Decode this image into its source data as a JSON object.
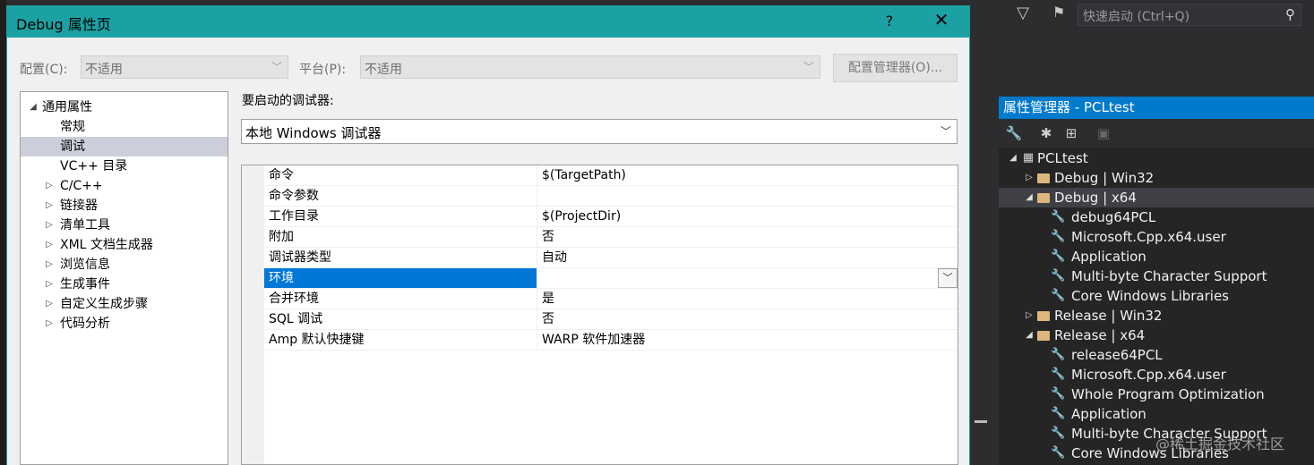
{
  "dialog": {
    "title": "Debug 属性页",
    "help": "?",
    "close": "✕",
    "config_label": "配置(C):",
    "config_value": "不适用",
    "platform_label": "平台(P):",
    "platform_value": "不适用",
    "config_manager": "配置管理器(O)...",
    "nav": [
      {
        "label": "通用属性",
        "expander": "◢",
        "indent": 0
      },
      {
        "label": "常规",
        "expander": "",
        "indent": 1
      },
      {
        "label": "调试",
        "expander": "",
        "indent": 1,
        "selected": true
      },
      {
        "label": "VC++ 目录",
        "expander": "",
        "indent": 1
      },
      {
        "label": "C/C++",
        "expander": "▷",
        "indent": 1
      },
      {
        "label": "链接器",
        "expander": "▷",
        "indent": 1
      },
      {
        "label": "清单工具",
        "expander": "▷",
        "indent": 1
      },
      {
        "label": "XML 文档生成器",
        "expander": "▷",
        "indent": 1
      },
      {
        "label": "浏览信息",
        "expander": "▷",
        "indent": 1
      },
      {
        "label": "生成事件",
        "expander": "▷",
        "indent": 1
      },
      {
        "label": "自定义生成步骤",
        "expander": "▷",
        "indent": 1
      },
      {
        "label": "代码分析",
        "expander": "▷",
        "indent": 1
      }
    ],
    "debugger_label": "要启动的调试器:",
    "debugger_value": "本地 Windows 调试器",
    "properties": [
      {
        "name": "命令",
        "value": "$(TargetPath)"
      },
      {
        "name": "命令参数",
        "value": ""
      },
      {
        "name": "工作目录",
        "value": "$(ProjectDir)"
      },
      {
        "name": "附加",
        "value": "否"
      },
      {
        "name": "调试器类型",
        "value": "自动"
      },
      {
        "name": "环境",
        "value": "",
        "selected": true
      },
      {
        "name": "合并环境",
        "value": "是"
      },
      {
        "name": "SQL 调试",
        "value": "否"
      },
      {
        "name": "Amp 默认快捷键",
        "value": "WARP 软件加速器"
      }
    ]
  },
  "quick_launch": {
    "placeholder": "快速启动 (Ctrl+Q)"
  },
  "property_manager": {
    "title": "属性管理器 - PCLtest",
    "tree": [
      {
        "label": "PCLtest",
        "type": "project",
        "level": 0,
        "expander": "◢"
      },
      {
        "label": "Debug | Win32",
        "type": "folder",
        "level": 1,
        "expander": "▷"
      },
      {
        "label": "Debug | x64",
        "type": "folder-open",
        "level": 1,
        "expander": "◢",
        "selected": true
      },
      {
        "label": "debug64PCL",
        "type": "sheet",
        "level": 2
      },
      {
        "label": "Microsoft.Cpp.x64.user",
        "type": "sheet",
        "level": 2
      },
      {
        "label": "Application",
        "type": "sheet",
        "level": 2
      },
      {
        "label": "Multi-byte Character Support",
        "type": "sheet",
        "level": 2
      },
      {
        "label": "Core Windows Libraries",
        "type": "sheet",
        "level": 2
      },
      {
        "label": "Release | Win32",
        "type": "folder",
        "level": 1,
        "expander": "▷"
      },
      {
        "label": "Release | x64",
        "type": "folder-open",
        "level": 1,
        "expander": "◢"
      },
      {
        "label": "release64PCL",
        "type": "sheet",
        "level": 2
      },
      {
        "label": "Microsoft.Cpp.x64.user",
        "type": "sheet",
        "level": 2
      },
      {
        "label": "Whole Program Optimization",
        "type": "sheet",
        "level": 2
      },
      {
        "label": "Application",
        "type": "sheet",
        "level": 2
      },
      {
        "label": "Multi-byte Character Support",
        "type": "sheet",
        "level": 2
      },
      {
        "label": "Core Windows Libraries",
        "type": "sheet",
        "level": 2
      }
    ]
  },
  "watermark": "@稀土掘金技术社区"
}
